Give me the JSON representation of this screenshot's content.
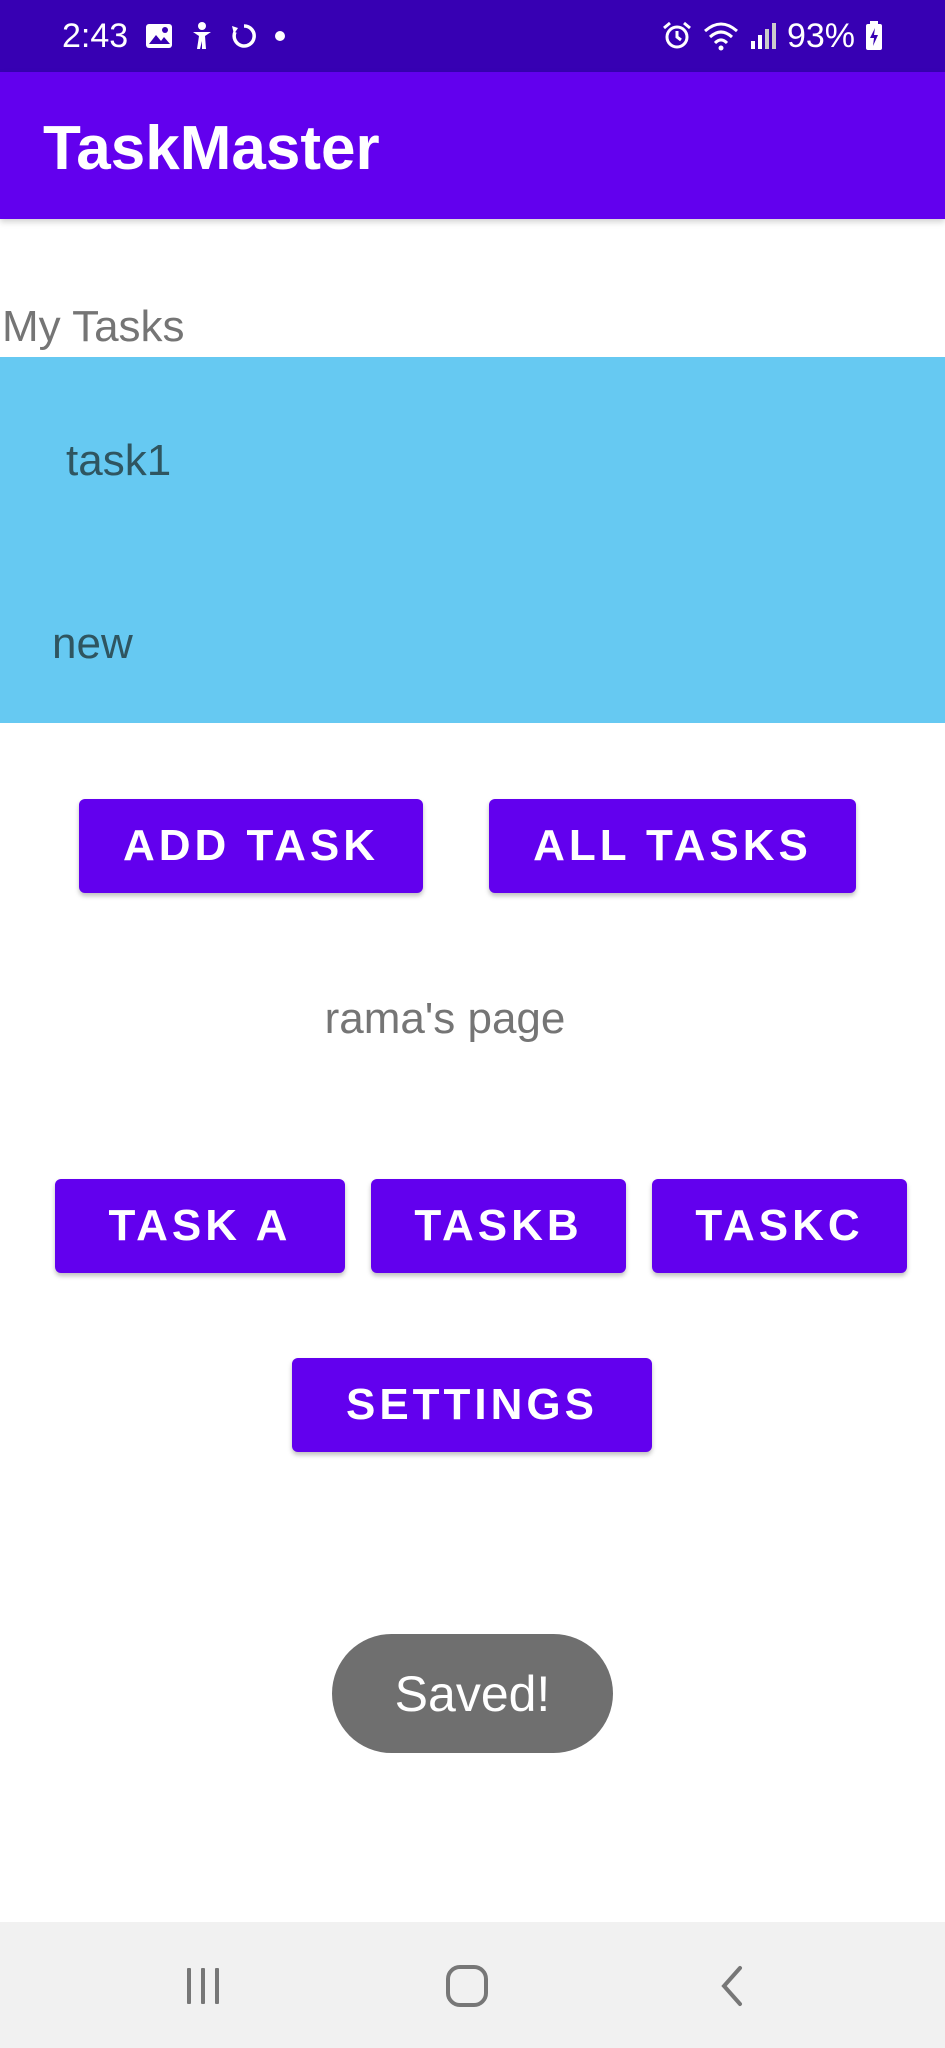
{
  "status_bar": {
    "time": "2:43",
    "battery": "93%",
    "icons_left": [
      "image-icon",
      "accessibility-icon",
      "sync-icon",
      "dot-icon"
    ],
    "icons_right": [
      "alarm-icon",
      "wifi-icon",
      "signal-icon",
      "battery-icon"
    ]
  },
  "app_bar": {
    "title": "TaskMaster",
    "color": "#6200EE"
  },
  "main": {
    "heading": "My Tasks",
    "tasks": [
      {
        "label": "task1"
      },
      {
        "label": "new"
      }
    ],
    "list_color": "#66C9F2",
    "buttons": {
      "add_task": "ADD TASK",
      "all_tasks": "ALL TASKS",
      "task_a": "TASK A",
      "task_b": "TASKB",
      "task_c": "TASKC",
      "settings": "SETTINGS"
    },
    "page_owner": "rama's page"
  },
  "toast": {
    "message": "Saved!"
  },
  "nav_bar": {
    "icons": [
      "recents-icon",
      "home-icon",
      "back-icon"
    ]
  }
}
